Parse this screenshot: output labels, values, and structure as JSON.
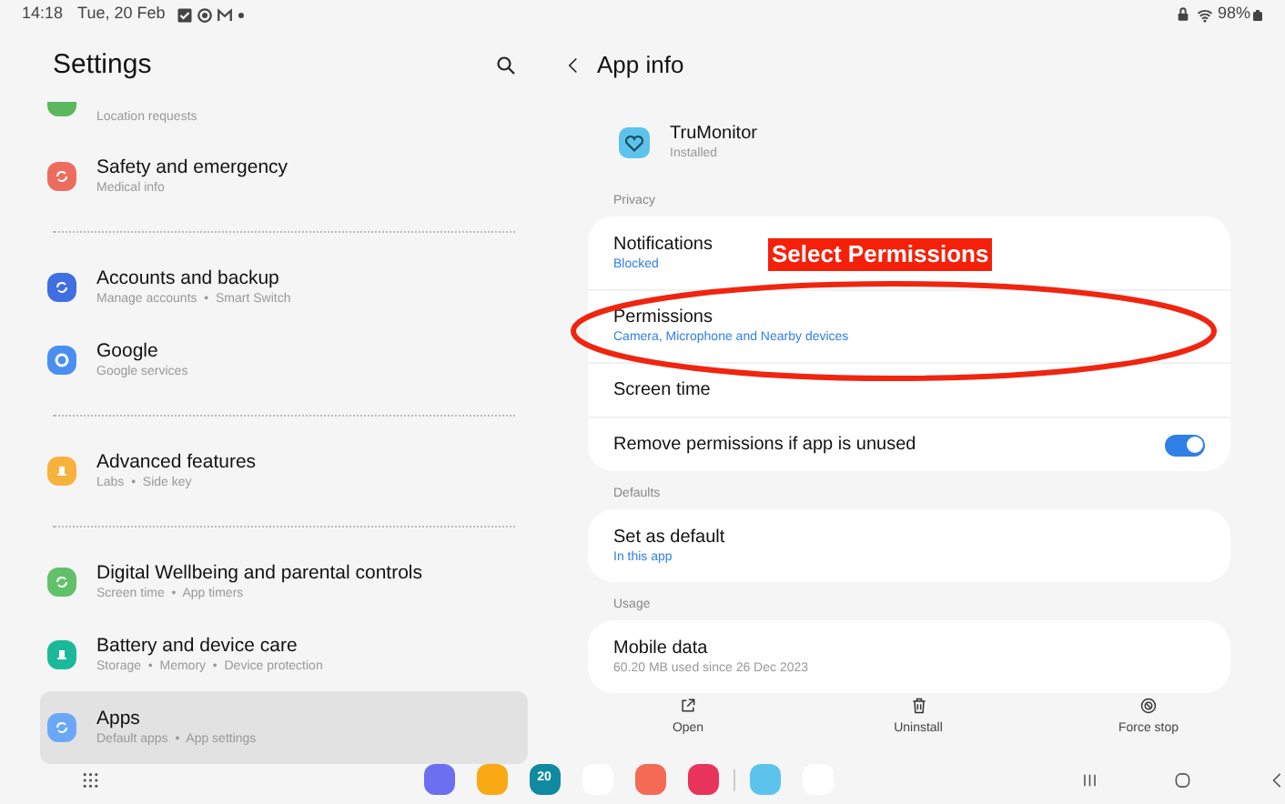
{
  "status_bar": {
    "time": "14:18",
    "date": "Tue, 20 Feb",
    "battery": "98%"
  },
  "settings": {
    "title": "Settings",
    "groups": [
      [
        {
          "subtitle": "Location requests",
          "color": "#5cb85c"
        },
        {
          "title": "Safety and emergency",
          "subtitle": "Medical info",
          "color": "#ec6d5e",
          "selected": false
        }
      ],
      [
        {
          "title": "Accounts and backup",
          "subtitle": "Manage accounts  •  Smart Switch",
          "color": "#3f6fe0",
          "selected": false
        },
        {
          "title": "Google",
          "subtitle": "Google services",
          "color": "#4a8ff0",
          "selected": false
        }
      ],
      [
        {
          "title": "Advanced features",
          "subtitle": "Labs  •  Side key",
          "color": "#f7b23b",
          "selected": false
        }
      ],
      [
        {
          "title": "Digital Wellbeing and parental controls",
          "subtitle": "Screen time  •  App timers",
          "color": "#62c06a",
          "selected": false
        },
        {
          "title": "Battery and device care",
          "subtitle": "Storage  •  Memory  •  Device protection",
          "color": "#1bb99a",
          "selected": false
        },
        {
          "title": "Apps",
          "subtitle": "Default apps  •  App settings",
          "color": "#6aa8f7",
          "selected": true
        }
      ]
    ]
  },
  "app_info": {
    "title": "App info",
    "app_name": "TruMonitor",
    "app_status": "Installed",
    "sections": [
      {
        "label": "Privacy",
        "rows": [
          {
            "kind": "text",
            "title": "Notifications",
            "subtitle": "Blocked"
          },
          {
            "kind": "text",
            "title": "Permissions",
            "subtitle": "Camera, Microphone and Nearby devices"
          },
          {
            "kind": "text",
            "title": "Screen time"
          },
          {
            "kind": "toggle",
            "title": "Remove permissions if app is unused",
            "on": true
          }
        ]
      },
      {
        "label": "Defaults",
        "rows": [
          {
            "kind": "text",
            "title": "Set as default",
            "subtitle": "In this app"
          }
        ]
      },
      {
        "label": "Usage",
        "rows": [
          {
            "kind": "text",
            "title": "Mobile data",
            "note": "60.20 MB used since 26 Dec 2023"
          }
        ]
      }
    ],
    "actions": [
      {
        "kind": "open",
        "label": "Open"
      },
      {
        "kind": "uninstall",
        "label": "Uninstall"
      },
      {
        "kind": "stop",
        "label": "Force stop"
      }
    ]
  },
  "annotation": {
    "label": "Select Permissions"
  },
  "dock": [
    {
      "color": "#6b6ff0"
    },
    {
      "color": "#f9a914"
    },
    {
      "color": "#0f8aa0",
      "label": "20"
    },
    {
      "color": "#ffffff"
    },
    {
      "color": "#f56a55"
    },
    {
      "color": "#e8345a"
    },
    {
      "color": "#5cc4ec"
    },
    {
      "color": "#ffffff"
    }
  ]
}
